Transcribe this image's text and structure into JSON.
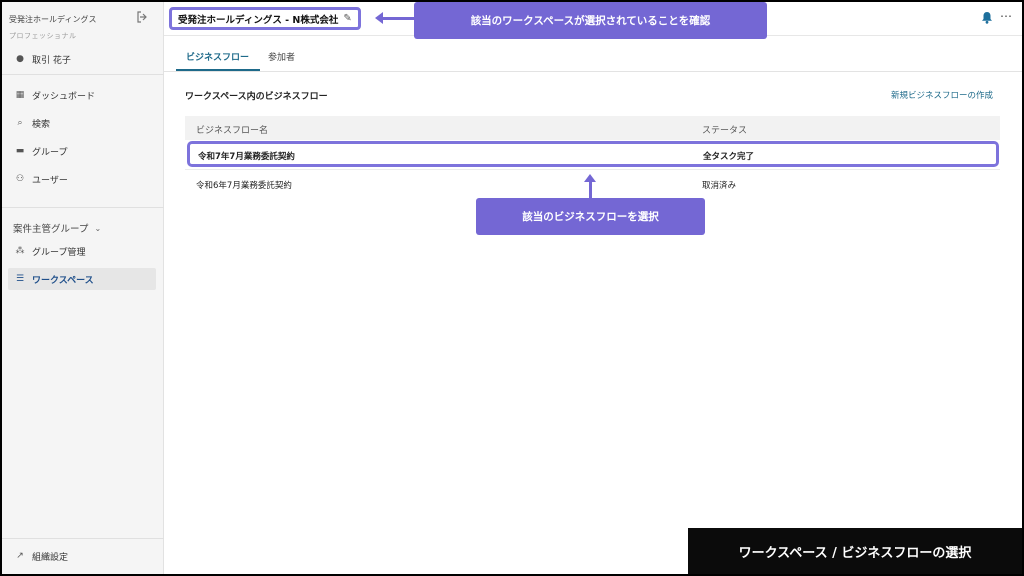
{
  "sidebar": {
    "org_name": "受発注ホールディングス",
    "plan": "プロフェッショナル",
    "user": "取引 花子",
    "items": [
      {
        "label": "ダッシュボード",
        "icon": "dashboard-icon"
      },
      {
        "label": "検索",
        "icon": "search-icon"
      },
      {
        "label": "グループ",
        "icon": "folder-icon"
      },
      {
        "label": "ユーザー",
        "icon": "users-icon"
      }
    ],
    "group_header": "案件主管グループ",
    "group_items": [
      {
        "label": "グループ管理",
        "icon": "group-icon"
      },
      {
        "label": "ワークスペース",
        "icon": "list-icon",
        "active": true
      }
    ],
    "settings": "組織設定"
  },
  "header": {
    "workspace_title": "受発注ホールディングス - N株式会社"
  },
  "callouts": {
    "top": "該当のワークスペースが選択されていることを確認",
    "middle": "該当のビジネスフローを選択"
  },
  "tabs": [
    {
      "label": "ビジネスフロー",
      "active": true
    },
    {
      "label": "参加者",
      "active": false
    }
  ],
  "main": {
    "section_title": "ワークスペース内のビジネスフロー",
    "new_link": "新規ビジネスフローの作成",
    "columns": [
      "ビジネスフロー名",
      "ステータス"
    ],
    "rows": [
      {
        "name": "令和7年7月業務委託契約",
        "status": "全タスク完了",
        "selected": true
      },
      {
        "name": "令和6年7月業務委託契約",
        "status": "取消済み",
        "selected": false
      }
    ]
  },
  "caption": "ワークスペース / ビジネスフローの選択",
  "colors": {
    "accent": "#7467d4",
    "link": "#1e6a8a"
  }
}
